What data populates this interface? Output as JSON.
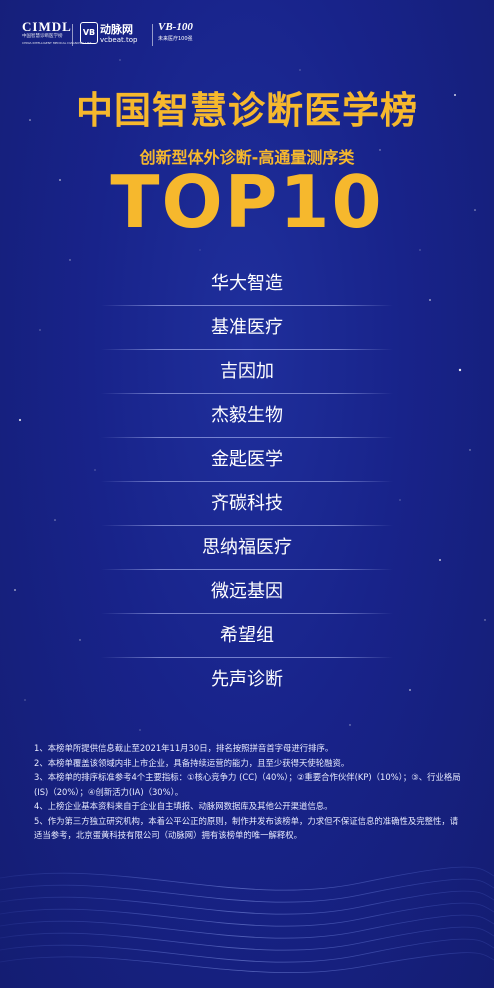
{
  "header": {
    "cimdl": {
      "main": "CIMDL",
      "sub1": "中国智慧诊断医学榜",
      "sub2": "CHINA INTELLIGENT MEDICAL DIAGNOSIS LIST"
    },
    "vcbeat": {
      "badge": "VB",
      "name": "动脉网",
      "url": "vcbeat.top"
    },
    "vb100": {
      "main": "VB-100",
      "sub": "未来医疗100强"
    }
  },
  "title": "中国智慧诊断医学榜",
  "subtitle": "创新型体外诊断-高通量测序类",
  "rank_label": "TOP10",
  "companies": [
    "华大智造",
    "基准医疗",
    "吉因加",
    "杰毅生物",
    "金匙医学",
    "齐碳科技",
    "思纳福医疗",
    "微远基因",
    "希望组",
    "先声诊断"
  ],
  "notes": [
    "1、本榜单所提供信息截止至2021年11月30日，排名按照拼音首字母进行排序。",
    "2、本榜单覆盖该领域内非上市企业，具备持续运营的能力，且至少获得天使轮融资。",
    "3、本榜单的排序标准参考4个主要指标：①核心竞争力 (CC)（40%）；②重要合作伙伴(KP)（10%）；③、行业格局(IS)（20%）；④创新活力(IA)（30%）。",
    "4、上榜企业基本资料来自于企业自主填报、动脉网数据库及其他公开渠道信息。",
    "5、作为第三方独立研究机构，本着公平公正的原则，制作并发布该榜单，力求但不保证信息的准确性及完整性，请适当参考，北京蛋黄科技有限公司（动脉网）拥有该榜单的唯一解释权。"
  ],
  "colors": {
    "background": "#18238a",
    "accent_gold": "#f6b82d",
    "text": "#ffffff"
  }
}
